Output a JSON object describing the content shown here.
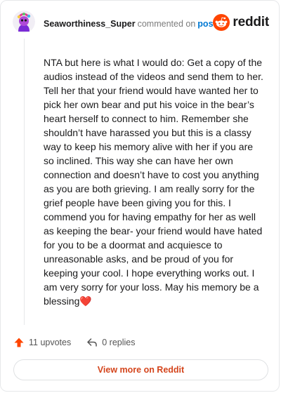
{
  "comment": {
    "username": "Seaworthiness_Super",
    "action_text": "commented on",
    "target_text": "post",
    "body": "NTA but here is what I would do: Get a copy of the audios instead of the videos and send them to her. Tell her that your friend would have wanted her to pick her own bear and put his voice in the bear’s heart herself to connect to him. Remember she shouldn’t have harassed you but this is a classy way to keep his memory alive with her if you are so inclined. This way she can have her own connection and doesn’t have to cost you anything as you are both grieving. I am really sorry for the grief people have been giving you for this. I commend you for having empathy for her as well as keeping the bear- your friend would have hated for you to be a doormat and acquiesce to unreasonable asks, and be proud of you for keeping your cool. I hope everything works out. I am very sorry for your loss. May his memory be a blessing",
    "body_end_emoji": "❤️",
    "upvotes_label": "11 upvotes",
    "replies_label": "0 replies"
  },
  "brand": {
    "wordmark": "reddit",
    "logo_icon": "reddit-snoo-icon",
    "color": "#ff4500"
  },
  "footer": {
    "view_more_label": "View more on Reddit"
  },
  "icons": {
    "upvote": "upvote-arrow-icon",
    "reply": "reply-arrow-icon",
    "avatar": "user-avatar"
  },
  "colors": {
    "upvote": "#ff4500",
    "link_blue": "#0079d3",
    "view_more_text": "#d4451c"
  }
}
